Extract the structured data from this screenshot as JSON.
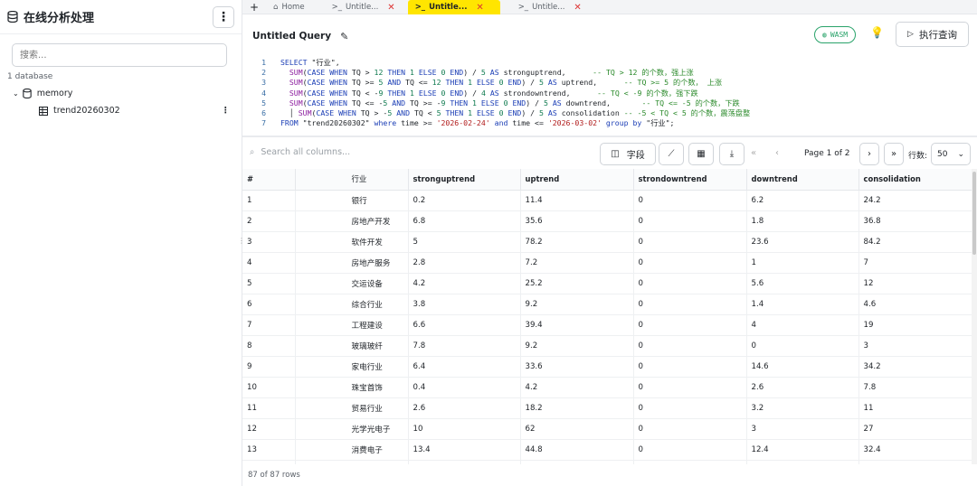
{
  "sidebar": {
    "title": "在线分析处理",
    "search_placeholder": "搜索...",
    "db_count": "1 database",
    "database": "memory",
    "table": "trend20260302"
  },
  "tabs": {
    "home": "Home",
    "t1": "Untitle...",
    "t2": "Untitle...",
    "t3": "Untitle..."
  },
  "toolbar": {
    "query_title": "Untitled Query",
    "wasm": "WASM",
    "run": "执行查询"
  },
  "editor": {
    "line_numbers": [
      "1",
      "2",
      "3",
      "4",
      "5",
      "6",
      "7"
    ]
  },
  "grid": {
    "search_placeholder": "Search all columns...",
    "fields_label": "字段",
    "page_info": "Page 1 of 2",
    "rows_label": "行数:",
    "rows_value": "50",
    "footer": "87 of 87 rows"
  },
  "columns": [
    "#",
    "行业",
    "stronguptrend",
    "uptrend",
    "strondowntrend",
    "downtrend",
    "consolidation"
  ],
  "rows": [
    [
      "1",
      "银行",
      "0.2",
      "11.4",
      "0",
      "6.2",
      "24.2"
    ],
    [
      "2",
      "房地产开发",
      "6.8",
      "35.6",
      "0",
      "1.8",
      "36.8"
    ],
    [
      "3",
      "软件开发",
      "5",
      "78.2",
      "0",
      "23.6",
      "84.2"
    ],
    [
      "4",
      "房地产服务",
      "2.8",
      "7.2",
      "0",
      "1",
      "7"
    ],
    [
      "5",
      "交运设备",
      "4.2",
      "25.2",
      "0",
      "5.6",
      "12"
    ],
    [
      "6",
      "综合行业",
      "3.8",
      "9.2",
      "0",
      "1.4",
      "4.6"
    ],
    [
      "7",
      "工程建设",
      "6.6",
      "39.4",
      "0",
      "4",
      "19"
    ],
    [
      "8",
      "玻璃玻纤",
      "7.8",
      "9.2",
      "0",
      "0",
      "3"
    ],
    [
      "9",
      "家电行业",
      "6.4",
      "33.6",
      "0",
      "14.6",
      "34.2"
    ],
    [
      "10",
      "珠宝首饰",
      "0.4",
      "4.2",
      "0",
      "2.6",
      "7.8"
    ],
    [
      "11",
      "贸易行业",
      "2.6",
      "18.2",
      "0",
      "3.2",
      "11"
    ],
    [
      "12",
      "光学光电子",
      "10",
      "62",
      "0",
      "3",
      "27"
    ],
    [
      "13",
      "消费电子",
      "13.4",
      "44.8",
      "0",
      "12.4",
      "32.4"
    ],
    [
      "",
      "",
      "",
      "",
      "",
      "",
      ""
    ]
  ]
}
